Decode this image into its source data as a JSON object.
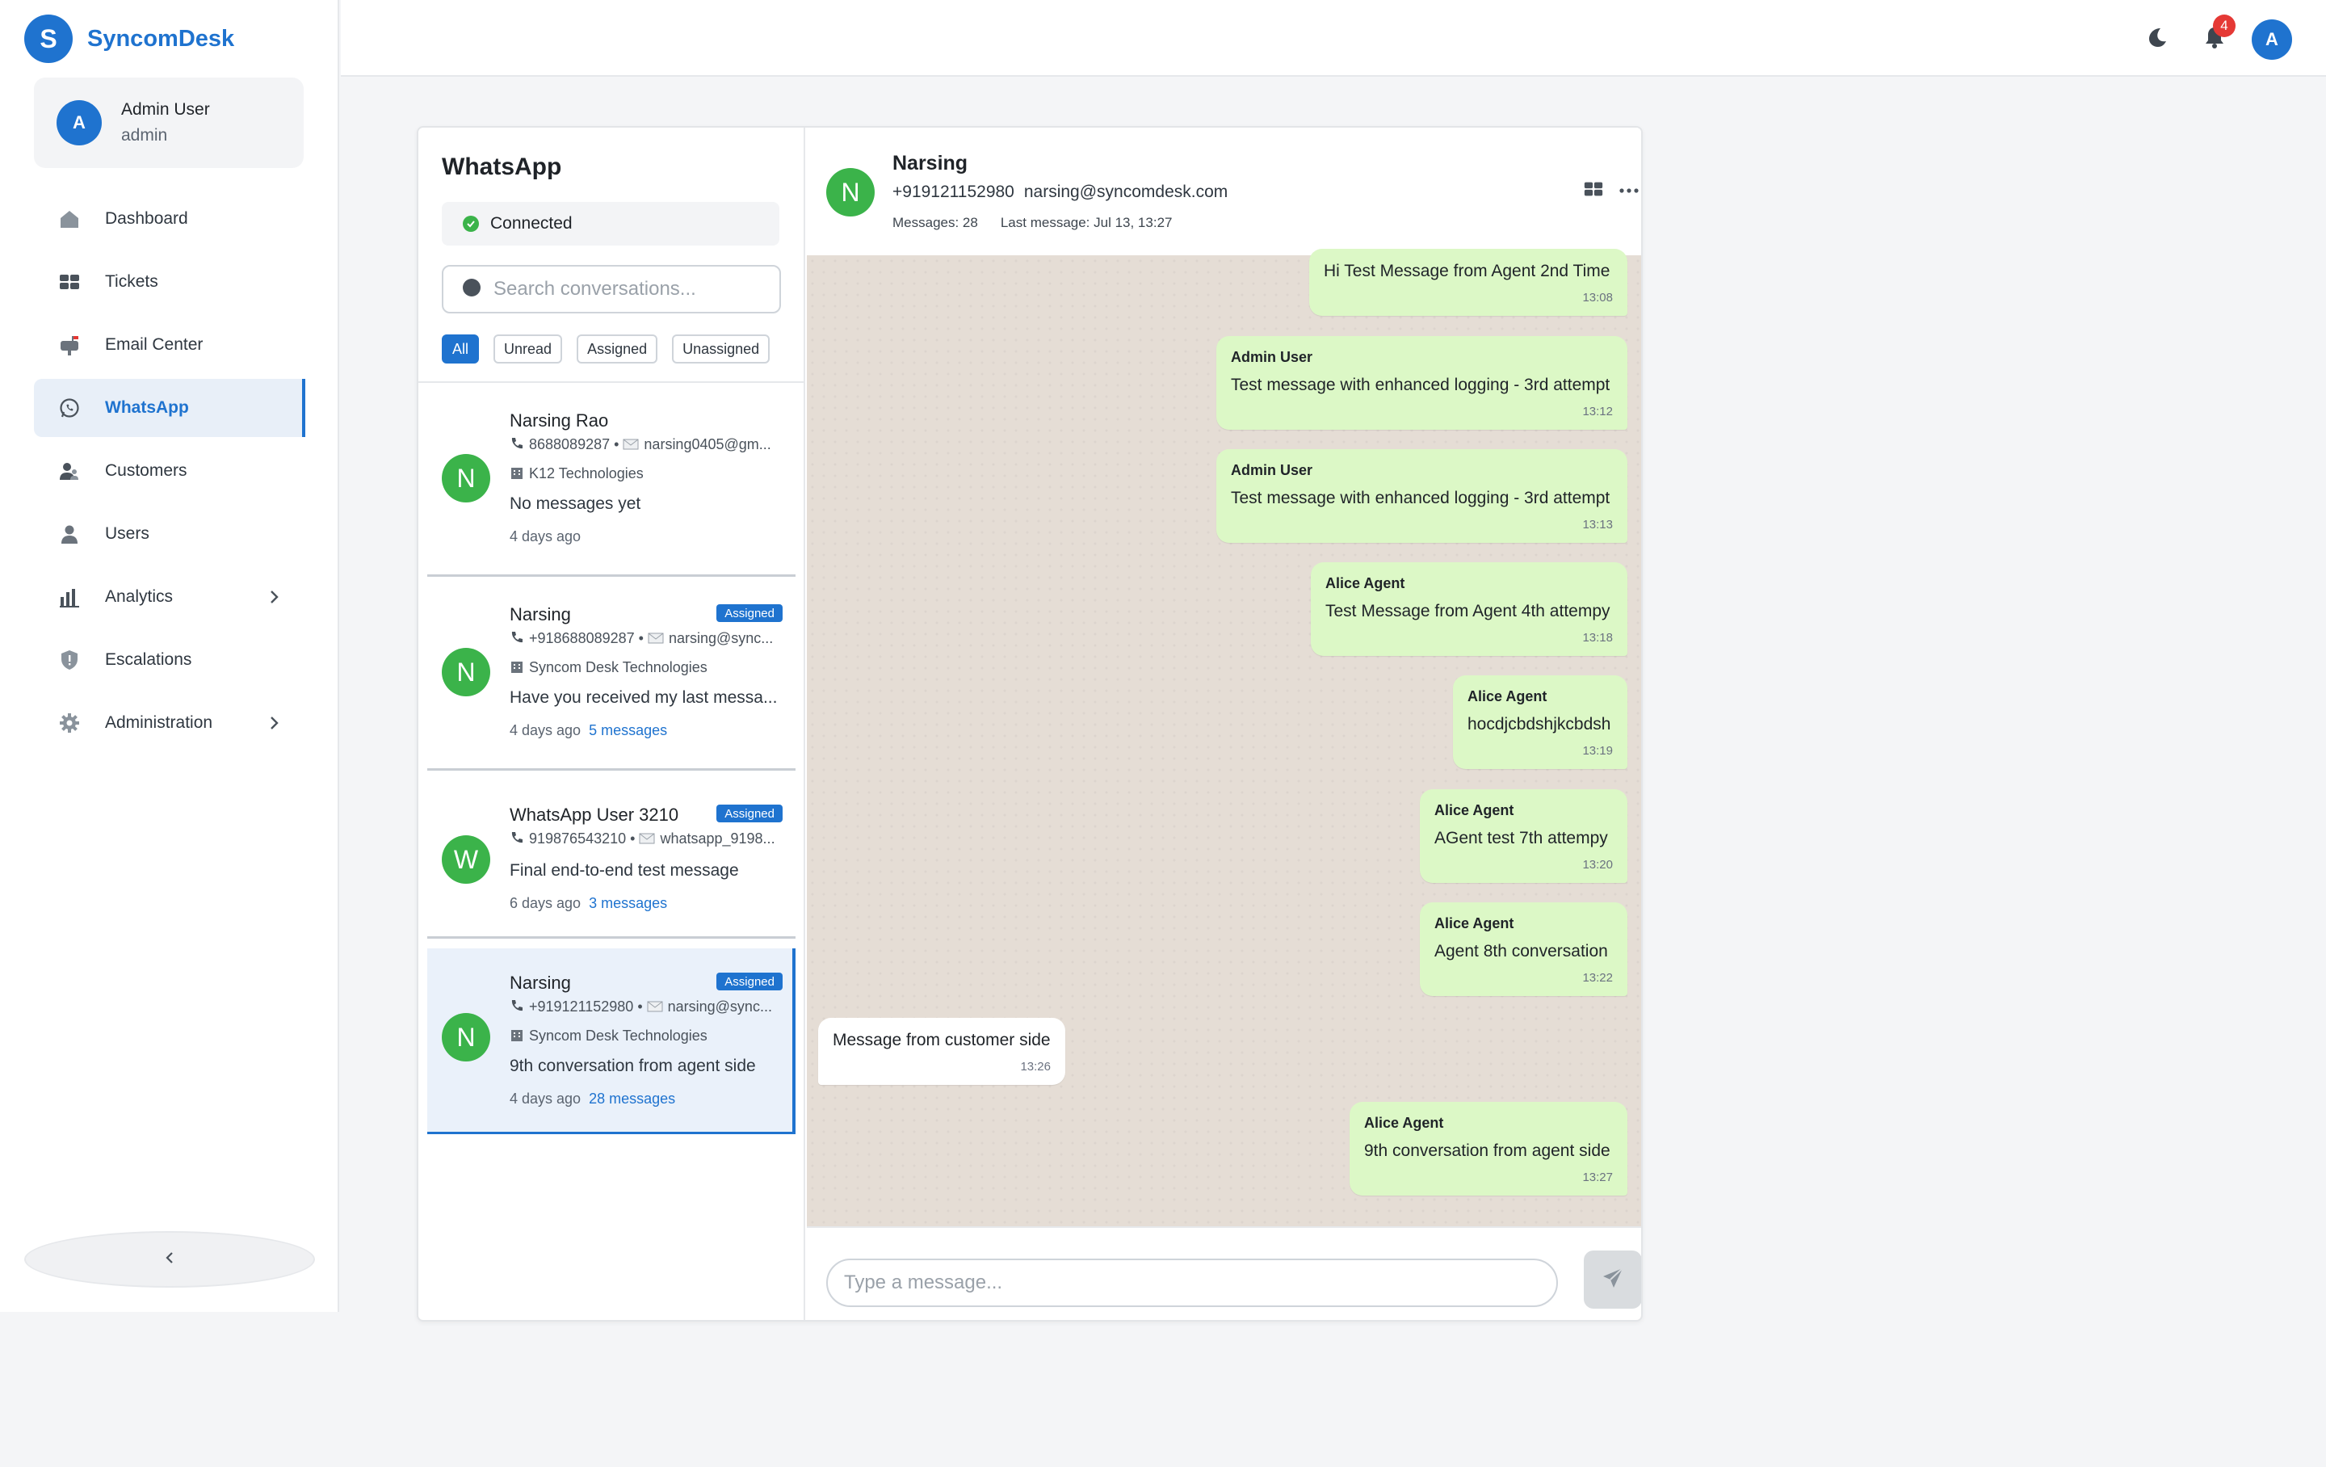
{
  "brand": {
    "logo_letter": "S",
    "name": "SyncomDesk"
  },
  "user": {
    "initial": "A",
    "name": "Admin User",
    "role": "admin"
  },
  "nav": [
    {
      "label": "Dashboard",
      "icon": "home-icon"
    },
    {
      "label": "Tickets",
      "icon": "tickets-icon"
    },
    {
      "label": "Email Center",
      "icon": "mailbox-icon"
    },
    {
      "label": "WhatsApp",
      "icon": "whatsapp-icon",
      "active": true
    },
    {
      "label": "Customers",
      "icon": "customers-icon"
    },
    {
      "label": "Users",
      "icon": "user-icon"
    },
    {
      "label": "Analytics",
      "icon": "bar-chart-icon",
      "has_submenu": true
    },
    {
      "label": "Escalations",
      "icon": "shield-icon"
    },
    {
      "label": "Administration",
      "icon": "gear-icon",
      "has_submenu": true
    }
  ],
  "topbar": {
    "notification_count": "4",
    "avatar_initial": "A"
  },
  "whatsapp": {
    "title": "WhatsApp",
    "status": "Connected",
    "search_placeholder": "Search conversations...",
    "filters": [
      "All",
      "Unread",
      "Assigned",
      "Unassigned"
    ],
    "active_filter": "All"
  },
  "conversations": [
    {
      "initial": "N",
      "name": "Narsing Rao",
      "badge": "",
      "phone": "8688089287",
      "email": "narsing0405@gm...",
      "company": "K12 Technologies",
      "preview": "No messages yet",
      "time": "4 days ago",
      "message_count": ""
    },
    {
      "initial": "N",
      "name": "Narsing",
      "badge": "Assigned",
      "phone": "+918688089287",
      "email": "narsing@sync...",
      "company": "Syncom Desk Technologies",
      "preview": "Have you received my last messa...",
      "time": "4 days ago",
      "message_count": "5 messages"
    },
    {
      "initial": "W",
      "name": "WhatsApp User 3210",
      "badge": "Assigned",
      "phone": "919876543210",
      "email": "whatsapp_9198...",
      "company": "",
      "preview": "Final end-to-end test message",
      "time": "6 days ago",
      "message_count": "3 messages"
    },
    {
      "initial": "N",
      "name": "Narsing",
      "badge": "Assigned",
      "phone": "+919121152980",
      "email": "narsing@sync...",
      "company": "Syncom Desk Technologies",
      "preview": "9th conversation from agent side",
      "time": "4 days ago",
      "message_count": "28 messages",
      "selected": true
    }
  ],
  "chat": {
    "initial": "N",
    "name": "Narsing",
    "phone": "+919121152980",
    "email": "narsing@syncomdesk.com",
    "messages_stat": "Messages: 28",
    "last_message_stat": "Last message: Jul 13, 13:27",
    "input_placeholder": "Type a message...",
    "messages": [
      {
        "direction": "out",
        "sender": "",
        "text": "Hi Test Message from Agent 2nd Time",
        "time": "13:08"
      },
      {
        "direction": "out",
        "sender": "Admin User",
        "text": "Test message with enhanced logging - 3rd attempt",
        "time": "13:12"
      },
      {
        "direction": "out",
        "sender": "Admin User",
        "text": "Test message with enhanced logging - 3rd attempt",
        "time": "13:13"
      },
      {
        "direction": "out",
        "sender": "Alice Agent",
        "text": "Test Message from Agent 4th attempy",
        "time": "13:18"
      },
      {
        "direction": "out",
        "sender": "Alice Agent",
        "text": "hocdjcbdshjkcbdsh",
        "time": "13:19"
      },
      {
        "direction": "out",
        "sender": "Alice Agent",
        "text": "AGent test 7th attempy",
        "time": "13:20"
      },
      {
        "direction": "out",
        "sender": "Alice Agent",
        "text": "Agent 8th conversation",
        "time": "13:22"
      },
      {
        "direction": "in",
        "sender": "",
        "text": "Message from customer side",
        "time": "13:26"
      },
      {
        "direction": "out",
        "sender": "Alice Agent",
        "text": "9th conversation from agent side",
        "time": "13:27"
      }
    ]
  },
  "colors": {
    "accent": "#1f73cf",
    "online": "#3bb34a",
    "badge_red": "#e53935",
    "outgoing_bubble": "#dcf8c6",
    "chat_bg": "#e5ddd5"
  }
}
